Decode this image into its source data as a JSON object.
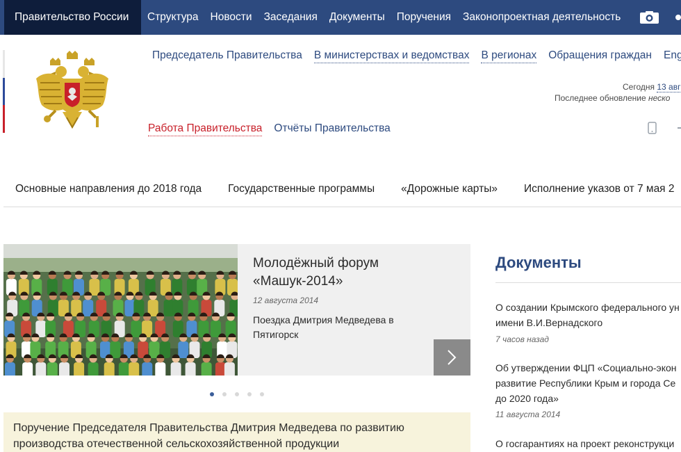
{
  "topbar": {
    "brand": "Правительство России",
    "items": [
      "Структура",
      "Новости",
      "Заседания",
      "Документы",
      "Поручения",
      "Законопроектная деятельность"
    ]
  },
  "header": {
    "sections": [
      "Председатель Правительства",
      "В министерствах и ведомствах",
      "В регионах",
      "Обращения граждан",
      "Eng"
    ],
    "today_label": "Сегодня",
    "today_value": "13 авг",
    "updated_label": "Последнее обновление",
    "updated_value": "неско",
    "subnav_active": "Работа Правительства",
    "subnav_other": "Отчёты Правительства"
  },
  "directions": [
    "Основные направления до 2018 года",
    "Государственные программы",
    "«Дорожные карты»",
    "Исполнение указов от 7 мая 2"
  ],
  "slider": {
    "title": "Молодёжный форум «Машук-2014»",
    "date": "12 августа 2014",
    "description": "Поездка Дмитрия Медведева в Пятигорск"
  },
  "notice": "Поручение Председателя Правительства Дмитрия Медведева по развитию производства отечественной сельскохозяйственной продукции",
  "documents": {
    "heading": "Документы",
    "items": [
      {
        "line1": "О создании Крымского федерального ун",
        "line2": "имени В.И.Вернадского",
        "time": "7 часов назад"
      },
      {
        "line1": "Об утверждении ФЦП «Социально-экон",
        "line2": "развитие Республики Крым и города Се",
        "line3": "до 2020 года»",
        "time": "11 августа 2014"
      },
      {
        "line1": "О госгарантиях на проект реконструкци"
      }
    ]
  },
  "colors": {
    "nav_blue": "#2d4a7f",
    "brand_dark": "#0e1d3b",
    "accent_red": "#c8202a",
    "notice_bg": "#f7f3dc"
  }
}
